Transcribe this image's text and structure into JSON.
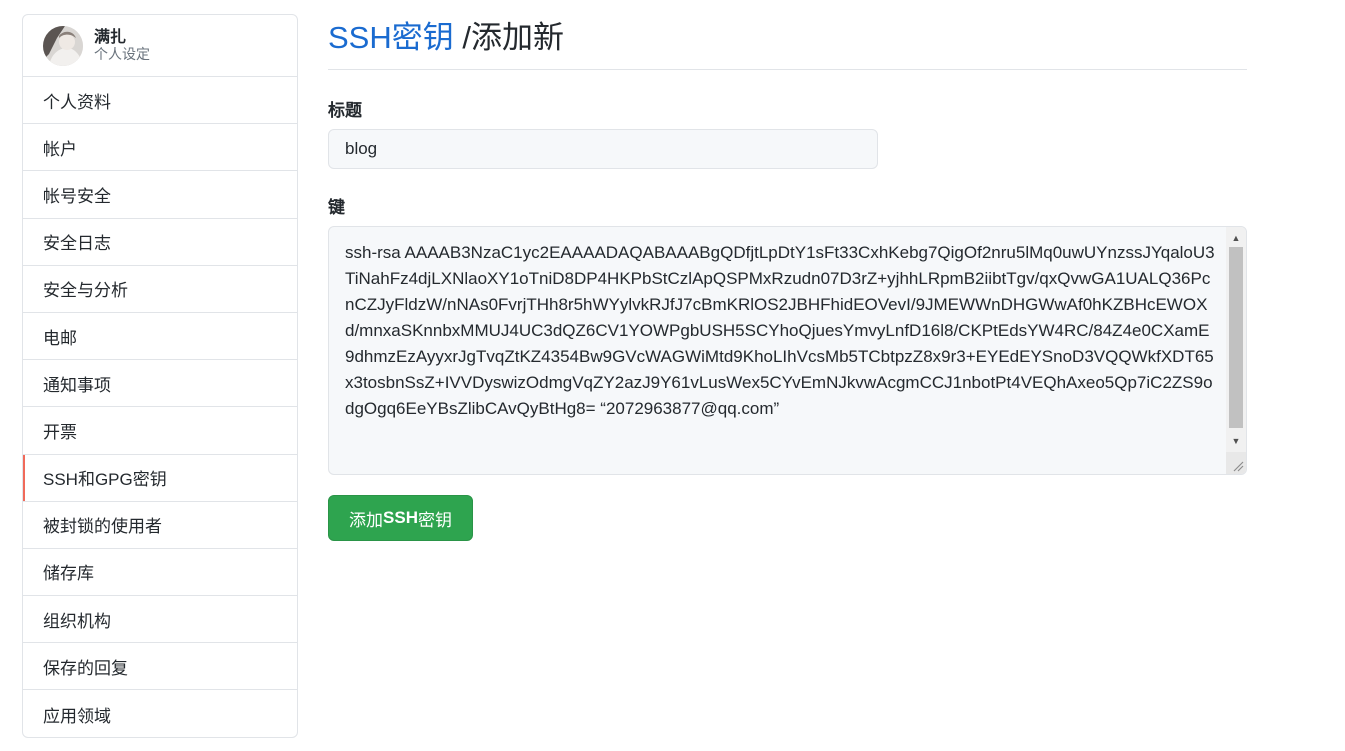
{
  "profile": {
    "name": "满扎",
    "subtitle": "个人设定"
  },
  "sidebar": {
    "items": [
      {
        "label": "个人资料"
      },
      {
        "label": "帐户"
      },
      {
        "label": "帐号安全"
      },
      {
        "label": "安全日志"
      },
      {
        "label": "安全与分析"
      },
      {
        "label": "电邮"
      },
      {
        "label": "通知事项"
      },
      {
        "label": "开票"
      },
      {
        "label": "SSH和GPG密钥",
        "selected": true
      },
      {
        "label": "被封锁的使用者"
      },
      {
        "label": "储存库"
      },
      {
        "label": "组织机构"
      },
      {
        "label": "保存的回复"
      },
      {
        "label": "应用领域"
      }
    ]
  },
  "header": {
    "breadcrumb": "SSH密钥",
    "title_suffix": " /添加新"
  },
  "form": {
    "title_label": "标题",
    "title_value": "blog",
    "key_label": "键",
    "key_value": "ssh-rsa AAAAB3NzaC1yc2EAAAADAQABAAABgQDfjtLpDtY1sFt33CxhKebg7QigOf2nru5lMq0uwUYnzssJYqaloU3TiNahFz4djLXNlaoXY1oTniD8DP4HKPbStCzlApQSPMxRzudn07D3rZ+yjhhLRpmB2iibtTgv/qxQvwGA1UALQ36PcnCZJyFldzW/nNAs0FvrjTHh8r5hWYylvkRJfJ7cBmKRlOS2JBHFhidEOVevI/9JMEWWnDHGWwAf0hKZBHcEWOXd/mnxaSKnnbxMMUJ4UC3dQZ6CV1YOWPgbUSH5SCYhoQjuesYmvyLnfD16l8/CKPtEdsYW4RC/84Z4e0CXamE9dhmzEzAyyxrJgTvqZtKZ4354Bw9GVcWAGWiMtd9KhoLIhVcsMb5TCbtpzZ8x9r3+EYEdEYSnoD3VQQWkfXDT65x3tosbnSsZ+IVVDyswizOdmgVqZY2azJ9Y61vLusWex5CYvEmNJkvwAcgmCCJ1nbotPt4VEQhAxeo5Qp7iC2ZS9odgOgq6EeYBsZlibCAvQyBtHg8= “2072963877@qq.com”",
    "submit_prefix": "添加",
    "submit_bold": "SSH",
    "submit_suffix": "密钥"
  },
  "colors": {
    "link_blue": "#1a6bd0",
    "submit_green": "#2ea44f",
    "selected_marker": "#f06a5a"
  }
}
